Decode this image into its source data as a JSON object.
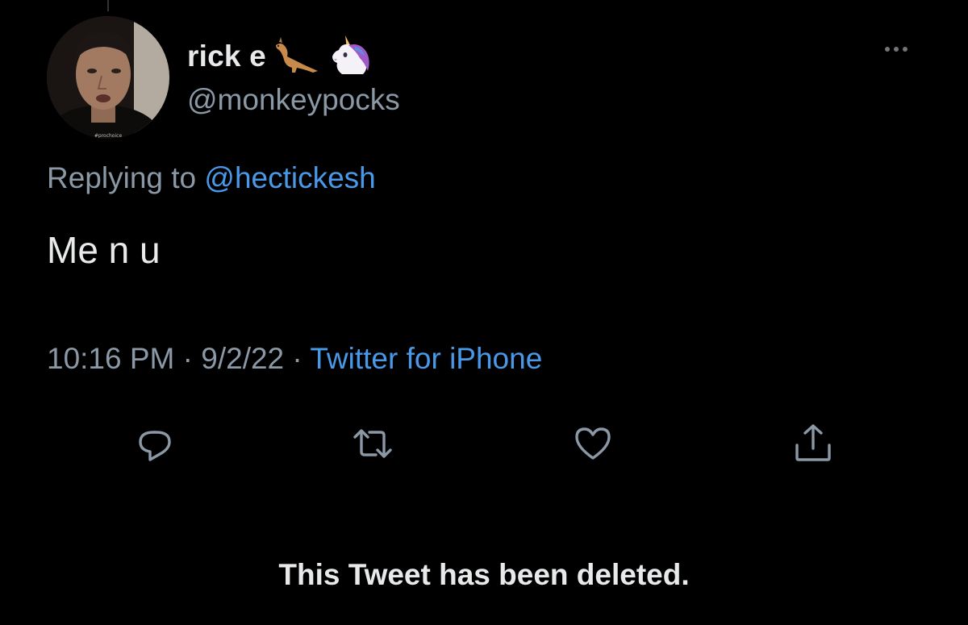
{
  "user": {
    "display_name": "rick e",
    "emojis": [
      "kangaroo-emoji",
      "unicorn-emoji"
    ],
    "handle": "@monkeypocks",
    "avatar_caption": "#prochoice"
  },
  "reply": {
    "prefix": "Replying to",
    "to_handle": "@hectickesh"
  },
  "tweet": {
    "text": "Me n u",
    "time": "10:16 PM",
    "separator": "·",
    "date": "9/2/22",
    "source": "Twitter for iPhone"
  },
  "actions": [
    "reply-icon",
    "retweet-icon",
    "like-icon",
    "share-icon"
  ],
  "footer": {
    "deleted_notice": "This Tweet has been deleted."
  },
  "colors": {
    "background": "#000000",
    "text_primary": "#e7e9ea",
    "text_secondary": "#8b98a5",
    "link": "#4a99e9"
  }
}
